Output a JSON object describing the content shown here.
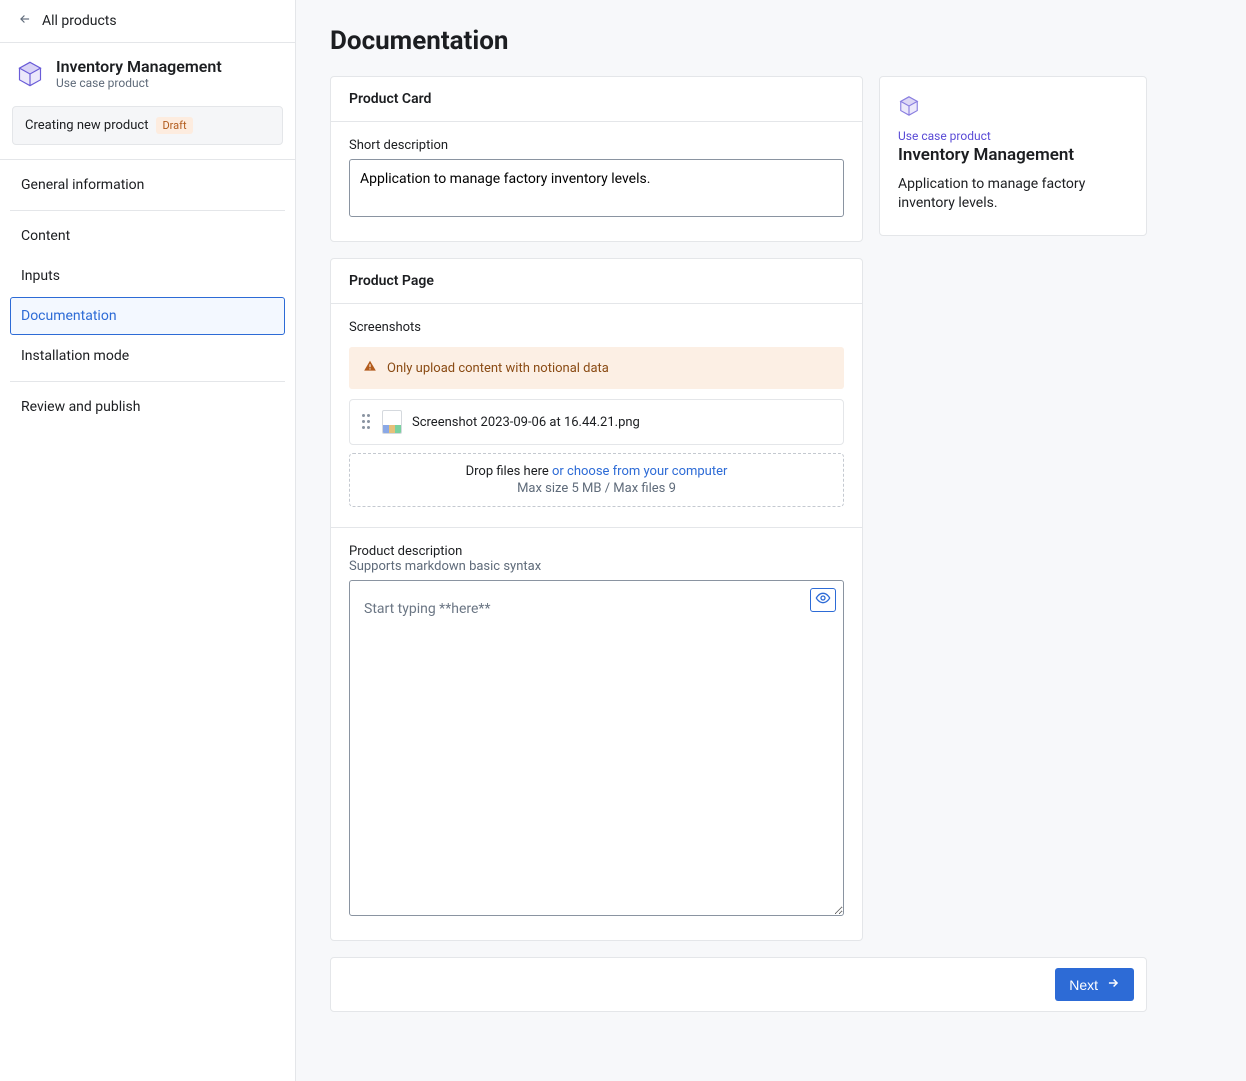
{
  "sidebar": {
    "back_label": "All products",
    "product_title": "Inventory Management",
    "product_type": "Use case product",
    "status_text": "Creating new product",
    "draft_label": "Draft",
    "nav": {
      "general": "General information",
      "content": "Content",
      "inputs": "Inputs",
      "documentation": "Documentation",
      "installation": "Installation mode",
      "review": "Review and publish"
    }
  },
  "page": {
    "title": "Documentation",
    "product_card": {
      "header": "Product Card",
      "short_desc_label": "Short description",
      "short_desc_value": "Application to manage factory inventory levels."
    },
    "product_page": {
      "header": "Product Page",
      "screenshots_label": "Screenshots",
      "warning_text": "Only upload content with notional data",
      "file_name": "Screenshot 2023-09-06 at 16.44.21.png",
      "dropzone_text": "Drop files here ",
      "dropzone_link": "or choose from your computer",
      "dropzone_hint": "Max size 5 MB / Max files 9",
      "desc_label": "Product description",
      "desc_sub": "Supports markdown basic syntax",
      "desc_placeholder": "Start typing **here**"
    },
    "preview": {
      "type": "Use case product",
      "title": "Inventory Management",
      "desc": "Application to manage factory inventory levels."
    },
    "footer": {
      "next_label": "Next"
    }
  }
}
